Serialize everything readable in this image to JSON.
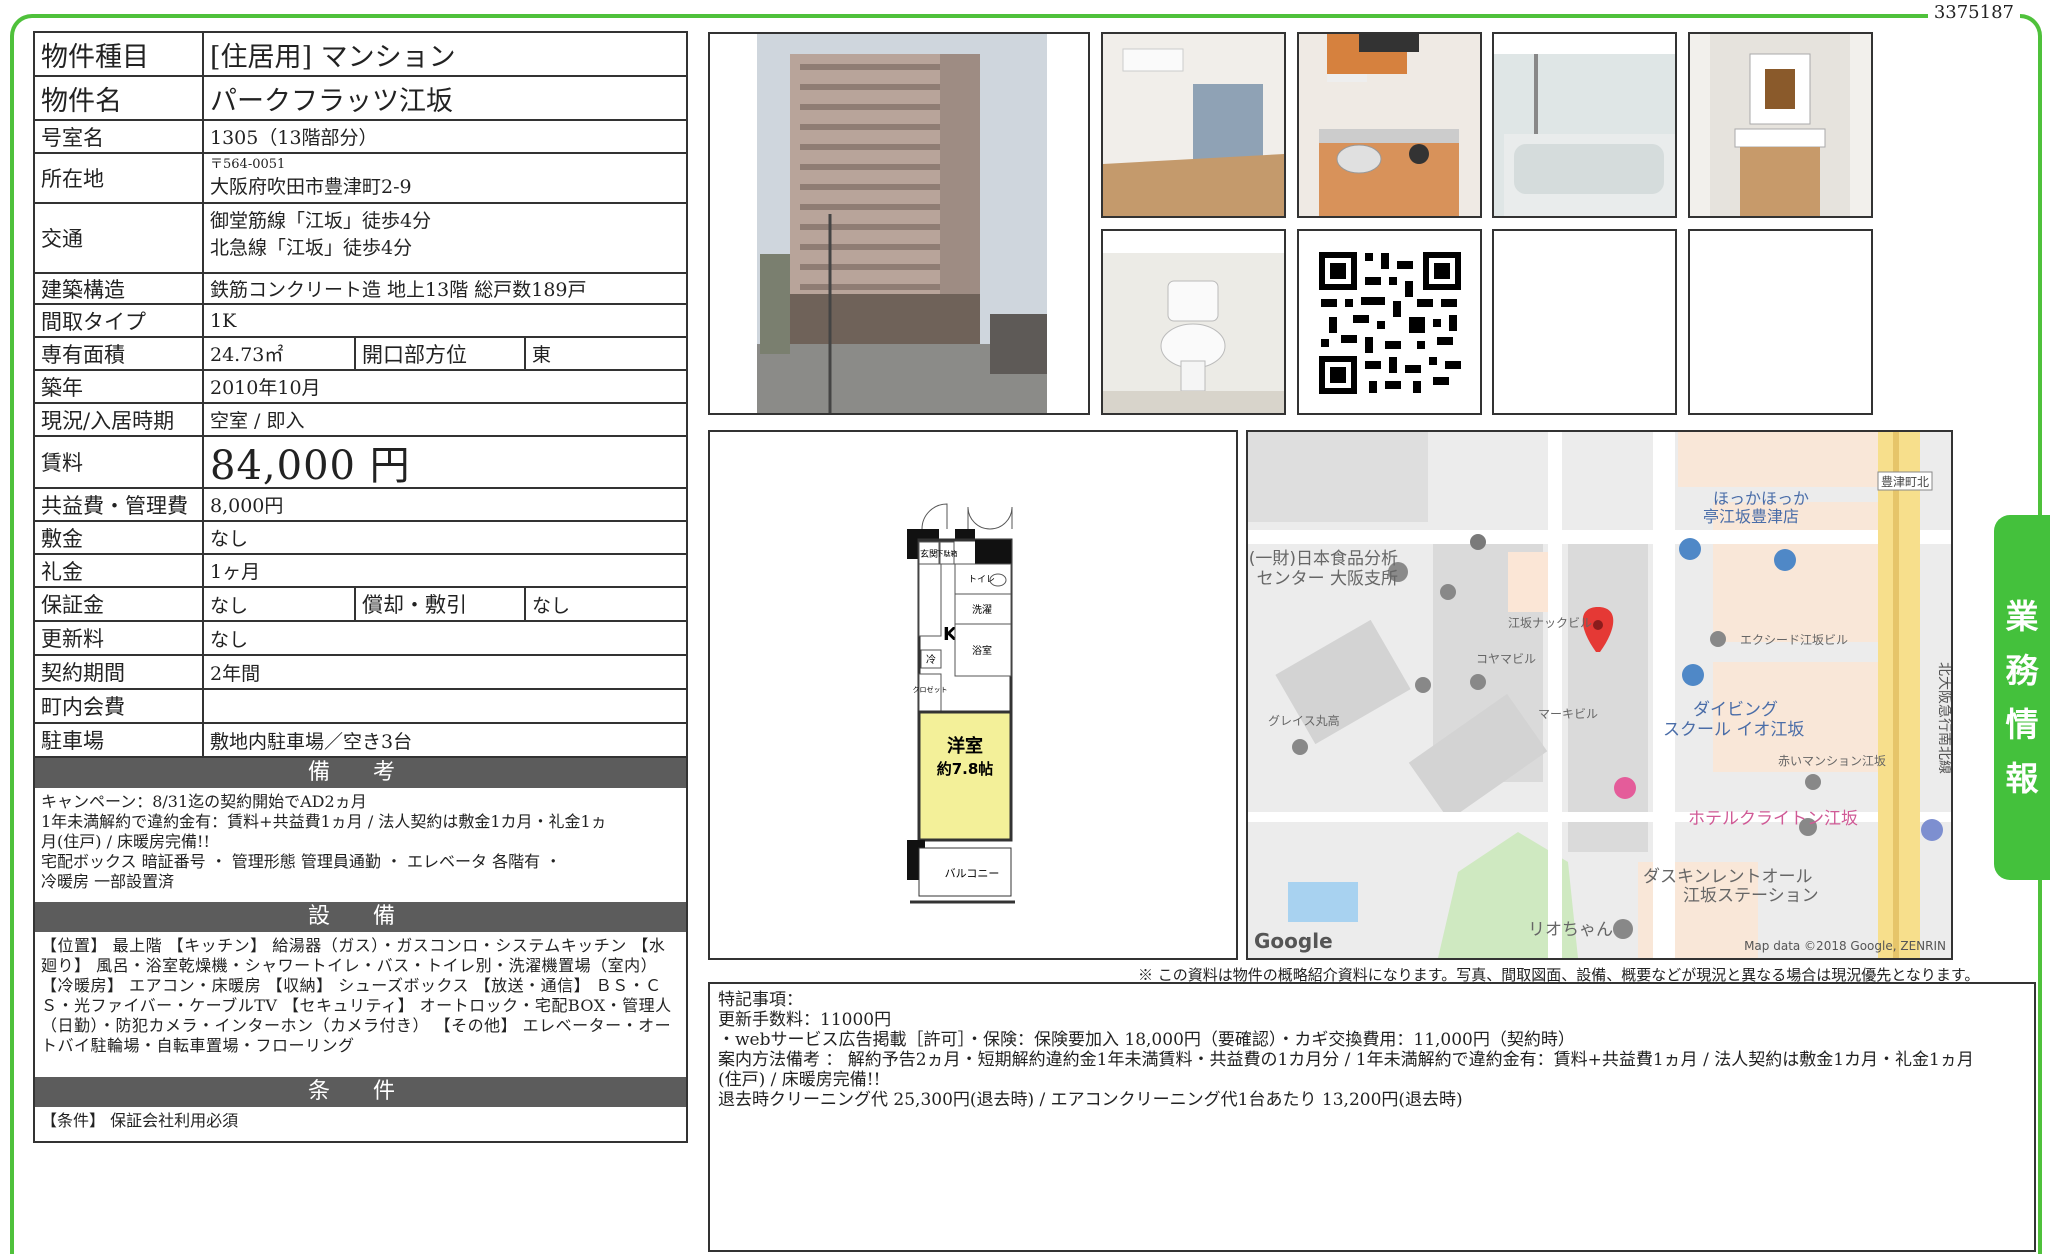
{
  "doc_id": "3375187",
  "side_tab": [
    "業",
    "務",
    "情",
    "報"
  ],
  "spec": {
    "property_type": {
      "label": "物件種目",
      "value": "[住居用] マンション"
    },
    "property_name": {
      "label": "物件名",
      "value": "パークフラッツ江坂"
    },
    "room_no": {
      "label": "号室名",
      "value": "1305（13階部分）"
    },
    "address": {
      "label": "所在地",
      "zip": "〒564-0051",
      "value": "大阪府吹田市豊津町2-9"
    },
    "transport": {
      "label": "交通",
      "line1": "御堂筋線「江坂」徒歩4分",
      "line2": "北急線「江坂」徒歩4分"
    },
    "structure": {
      "label": "建築構造",
      "value": "鉄筋コンクリート造 地上13階 総戸数189戸"
    },
    "layout": {
      "label": "間取タイプ",
      "value": "1K"
    },
    "area": {
      "label": "専有面積",
      "value": "24.73㎡",
      "facing_label": "開口部方位",
      "facing_value": "東"
    },
    "built": {
      "label": "築年",
      "value": "2010年10月"
    },
    "status": {
      "label": "現況/入居時期",
      "value": "空室 / 即入"
    },
    "rent": {
      "label": "賃料",
      "value": "84,000 円"
    },
    "common_fee": {
      "label": "共益費・管理費",
      "value": "8,000円"
    },
    "deposit": {
      "label": "敷金",
      "value": "なし"
    },
    "key_money": {
      "label": "礼金",
      "value": "1ヶ月"
    },
    "guarantee": {
      "label": "保証金",
      "value": "なし",
      "amort_label": "償却・敷引",
      "amort_value": "なし"
    },
    "renewal": {
      "label": "更新料",
      "value": "なし"
    },
    "contract": {
      "label": "契約期間",
      "value": "2年間"
    },
    "town_fee": {
      "label": "町内会費",
      "value": ""
    },
    "parking": {
      "label": "駐車場",
      "value": "敷地内駐車場／空き3台"
    }
  },
  "notes": {
    "title": "備 考",
    "lines": [
      "キャンペーン：8/31迄の契約開始でAD2ヵ月",
      "1年未満解約で違約金有：賃料+共益費1ヵ月 / 法人契約は敷金1カ月・礼金1ヵ",
      "月(住戸) / 床暖房完備!!",
      "宅配ボックス 暗証番号 ・ 管理形態 管理員通勤 ・ エレベータ 各階有 ・",
      "冷暖房 一部設置済"
    ]
  },
  "facilities": {
    "title": "設 備",
    "text": "【位置】 最上階 【キッチン】 給湯器（ガス）・ガスコンロ・システムキッチン 【水廻り】 風呂・浴室乾燥機・シャワートイレ・バス・トイレ別・洗濯機置場（室内） 【冷暖房】 エアコン・床暖房 【収納】 シューズボックス 【放送・通信】 ＢＳ・ＣＳ・光ファイバー・ケーブルTV 【セキュリティ】 オートロック・宅配BOX・管理人（日勤）・防犯カメラ・インターホン（カメラ付き） 【その他】 エレベーター・オートバイ駐輪場・自転車置場・フローリング"
  },
  "conditions": {
    "title": "条 件",
    "text": "【条件】 保証会社利用必須"
  },
  "floorplan": {
    "entrance": "玄関",
    "shoebox": "下駄箱",
    "toilet": "トイレ",
    "laundry": "洗濯",
    "kitchen": "K",
    "bath": "浴室",
    "fridge": "冷",
    "closet": "クロゼット",
    "room_name": "洋室",
    "room_size": "約7.8帖",
    "balcony": "バルコニー"
  },
  "map": {
    "labels": [
      "(一財)日本食品分析センター 大阪支所",
      "ほっかほっか亭江坂豊津店",
      "豊津町北",
      "江坂ナックビル",
      "コヤマビル",
      "エクシード江坂ビル",
      "マーキビル",
      "グレイス丸高",
      "ダイビングスクール イオ江坂",
      "赤いマンション江坂",
      "ホテルクライトン江坂",
      "ダスキンレントオール江坂ステーション",
      "リオちゃん",
      "北大阪急行南北線"
    ],
    "logo": "Google",
    "attribution": "Map data ©2018 Google, ZENRIN"
  },
  "disclaimer": "※ この資料は物件の概略紹介資料になります。写真、間取図面、設備、概要などが現況と異なる場合は現況優先となります。",
  "remarks": {
    "lines": [
      "特記事項：",
      "更新手数料：11000円",
      "・webサービス広告掲載［許可］・保険：保険要加入 18,000円（要確認）・カギ交換費用：11,000円（契約時）",
      "案内方法備考 ： 解約予告2ヵ月・短期解約違約金1年未満賃料・共益費の1カ月分 / 1年未満解約で違約金有：賃料+共益費1ヵ月 / 法人契約は敷金1カ月・礼金1ヵ月",
      "(住戸) / 床暖房完備!!",
      "退去時クリーニング代 25,300円(退去時) / エアコンクリーニング代1台あたり 13,200円(退去時)"
    ]
  }
}
